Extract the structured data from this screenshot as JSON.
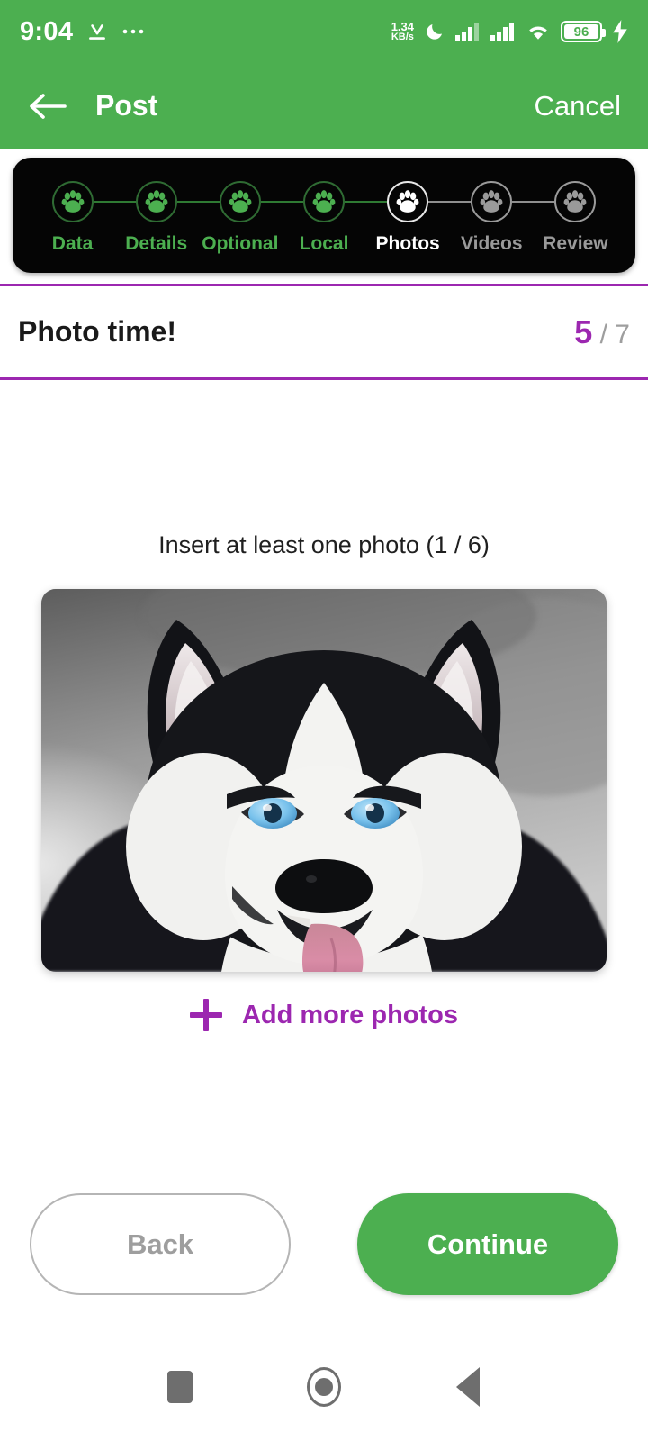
{
  "status_bar": {
    "time": "9:04",
    "download_icon": "download-underline-icon",
    "more_icon": "more-horizontal-icon",
    "net_speed_value": "1.34",
    "net_speed_unit": "KB/s",
    "dnd_icon": "moon-icon",
    "signal1_icon": "signal-bars-icon",
    "signal2_icon": "signal-bars-icon",
    "wifi_icon": "wifi-icon",
    "battery_percent": "96",
    "charging_icon": "lightning-bolt-icon"
  },
  "app_bar": {
    "back_icon": "arrow-left-icon",
    "title": "Post",
    "action_label": "Cancel"
  },
  "stepper": {
    "steps": [
      {
        "label": "Data",
        "state": "done",
        "icon": "paw-icon"
      },
      {
        "label": "Details",
        "state": "done",
        "icon": "paw-icon"
      },
      {
        "label": "Optional",
        "state": "done",
        "icon": "paw-icon"
      },
      {
        "label": "Local",
        "state": "done",
        "icon": "paw-icon"
      },
      {
        "label": "Photos",
        "state": "current",
        "icon": "paw-icon"
      },
      {
        "label": "Videos",
        "state": "todo",
        "icon": "paw-icon"
      },
      {
        "label": "Review",
        "state": "todo",
        "icon": "paw-icon"
      }
    ]
  },
  "section": {
    "title": "Photo time!",
    "current_step": "5",
    "total_steps": "/ 7"
  },
  "main": {
    "hint": "Insert at least one photo (1 / 6)",
    "photo_alt": "husky-dog-photo",
    "add_more_label": "Add more photos",
    "add_more_icon": "plus-icon"
  },
  "footer": {
    "back_label": "Back",
    "continue_label": "Continue"
  },
  "nav_bar": {
    "recents_icon": "square-icon",
    "home_icon": "circle-icon",
    "back_icon": "triangle-left-icon"
  },
  "colors": {
    "green": "#4CAF50",
    "purple": "#9C27B0",
    "stepper_bg": "#050505",
    "inactive_gray": "#9a9a9a"
  }
}
